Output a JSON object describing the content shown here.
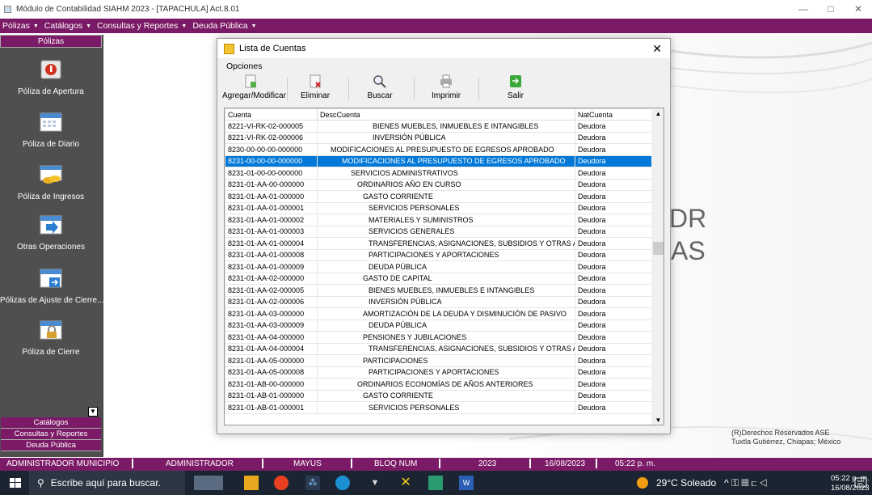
{
  "window": {
    "title": "Módulo de Contabilidad SIAHM 2023 - [TAPACHULA] Act.8.01",
    "min": "—",
    "max": "□",
    "close": "✕"
  },
  "menu": [
    "Pólizas",
    "Catálogos",
    "Consultas y Reportes",
    "Deuda Pública"
  ],
  "sidebar": {
    "header": "Pólizas",
    "items": [
      {
        "label": "Póliza de Apertura",
        "icon": "open-book-icon"
      },
      {
        "label": "Póliza de Diario",
        "icon": "calendar-icon"
      },
      {
        "label": "Póliza de Ingresos",
        "icon": "coins-icon"
      },
      {
        "label": "Otras Operaciones",
        "icon": "calendar-arrow-icon"
      },
      {
        "label": "Pólizas de Ajuste de Cierre...",
        "icon": "calendar-adjust-icon"
      },
      {
        "label": "Póliza de Cierre",
        "icon": "lock-icon"
      }
    ],
    "bottom": [
      "Catálogos",
      "Consultas y Reportes",
      "Deuda Pública"
    ]
  },
  "background": {
    "brand_1": "DR",
    "brand_2": "AS",
    "rights_1": "(R)Derechos Reservados ASE",
    "rights_2": "Tuxtla Gutiérrez, Chiapas; México"
  },
  "dialog": {
    "title": "Lista de Cuentas",
    "options_label": "Opciones",
    "toolbar": {
      "add": "Agregar/Modificar",
      "delete": "Eliminar",
      "search": "Buscar",
      "print": "Imprimir",
      "exit": "Salir"
    },
    "columns": [
      "Cuenta",
      "DescCuenta",
      "NatCuenta"
    ],
    "rows": [
      {
        "c": "8221-VI-RK-02-000005",
        "d": "BIENES MUEBLES, INMUEBLES E INTANGIBLES",
        "n": "Deudora",
        "i": 6
      },
      {
        "c": "8221-VI-RK-02-000006",
        "d": "INVERSIÓN PÚBLICA",
        "n": "Deudora",
        "i": 6
      },
      {
        "c": "8230-00-00-00-000000",
        "d": "MODIFICACIONES AL PRESUPUESTO DE EGRESOS APROBADO",
        "n": "Deudora",
        "i": 0
      },
      {
        "c": "8231-00-00-00-000000",
        "d": "MODIFICACIONES AL PRESUPUESTO DE EGRESOS APROBADO",
        "n": "Deudora",
        "i": 1
      },
      {
        "c": "8231-01-00-00-000000",
        "d": "SERVICIOS ADMINISTRATIVOS",
        "n": "Deudora",
        "i": 2
      },
      {
        "c": "8231-01-AA-00-000000",
        "d": "ORDINARIOS AÑO EN CURSO",
        "n": "Deudora",
        "i": 3
      },
      {
        "c": "8231-01-AA-01-000000",
        "d": "GASTO CORRIENTE",
        "n": "Deudora",
        "i": 4
      },
      {
        "c": "8231-01-AA-01-000001",
        "d": "SERVICIOS PERSONALES",
        "n": "Deudora",
        "i": 5
      },
      {
        "c": "8231-01-AA-01-000002",
        "d": "MATERIALES Y SUMINISTROS",
        "n": "Deudora",
        "i": 5
      },
      {
        "c": "8231-01-AA-01-000003",
        "d": "SERVICIOS GENERALES",
        "n": "Deudora",
        "i": 5
      },
      {
        "c": "8231-01-AA-01-000004",
        "d": "TRANSFERENCIAS, ASIGNACIONES, SUBSIDIOS Y OTRAS AYUD...",
        "n": "Deudora",
        "i": 5
      },
      {
        "c": "8231-01-AA-01-000008",
        "d": "PARTICIPACIONES Y APORTACIONES",
        "n": "Deudora",
        "i": 5
      },
      {
        "c": "8231-01-AA-01-000009",
        "d": "DEUDA PÚBLICA",
        "n": "Deudora",
        "i": 5
      },
      {
        "c": "8231-01-AA-02-000000",
        "d": "GASTO DE CAPITAL",
        "n": "Deudora",
        "i": 4
      },
      {
        "c": "8231-01-AA-02-000005",
        "d": "BIENES MUEBLES, INMUEBLES E INTANGIBLES",
        "n": "Deudora",
        "i": 5
      },
      {
        "c": "8231-01-AA-02-000006",
        "d": "INVERSIÓN PÚBLICA",
        "n": "Deudora",
        "i": 5
      },
      {
        "c": "8231-01-AA-03-000000",
        "d": "AMORTIZACIÓN DE LA DEUDA Y DISMINUCIÓN DE PASIVO",
        "n": "Deudora",
        "i": 4
      },
      {
        "c": "8231-01-AA-03-000009",
        "d": "DEUDA PÚBLICA",
        "n": "Deudora",
        "i": 5
      },
      {
        "c": "8231-01-AA-04-000000",
        "d": "PENSIONES Y JUBILACIONES",
        "n": "Deudora",
        "i": 4
      },
      {
        "c": "8231-01-AA-04-000004",
        "d": "TRANSFERENCIAS, ASIGNACIONES, SUBSIDIOS Y OTRAS AYUD...",
        "n": "Deudora",
        "i": 5
      },
      {
        "c": "8231-01-AA-05-000000",
        "d": "PARTICIPACIONES",
        "n": "Deudora",
        "i": 4
      },
      {
        "c": "8231-01-AA-05-000008",
        "d": "PARTICIPACIONES Y APORTACIONES",
        "n": "Deudora",
        "i": 5
      },
      {
        "c": "8231-01-AB-00-000000",
        "d": "ORDINARIOS ECONOMÍAS DE AÑOS ANTERIORES",
        "n": "Deudora",
        "i": 3
      },
      {
        "c": "8231-01-AB-01-000000",
        "d": "GASTO CORRIENTE",
        "n": "Deudora",
        "i": 4
      },
      {
        "c": "8231-01-AB-01-000001",
        "d": "SERVICIOS PERSONALES",
        "n": "Deudora",
        "i": 5
      }
    ],
    "selected_row": 3
  },
  "status": {
    "user": "ADMINISTRADOR MUNICIPIO",
    "role": "ADMINISTRADOR",
    "caps": "MAYUS",
    "num": "BLOQ NUM",
    "year": "2023",
    "date": "16/08/2023",
    "time": "05:22 p. m."
  },
  "taskbar": {
    "search": "Escribe aquí para buscar.",
    "weather": "29°C  Soleado",
    "clock_time": "05:22 p. m.",
    "clock_date": "16/08/2023"
  },
  "colors": {
    "accent": "#7b1a66",
    "selection": "#0078d7"
  }
}
